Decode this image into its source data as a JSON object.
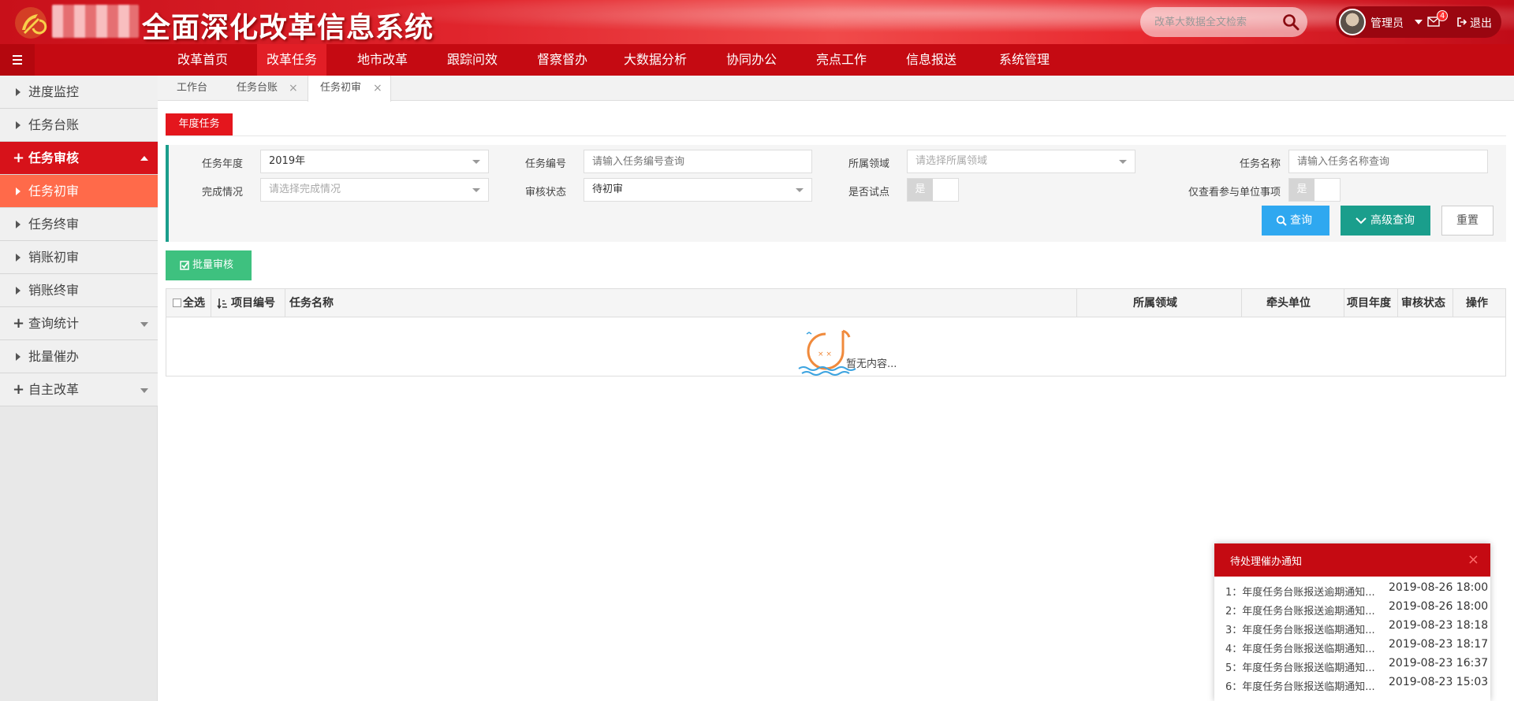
{
  "header": {
    "title": "全面深化改革信息系统",
    "search_placeholder": "改革大数据全文检索",
    "user_name": "管理员",
    "mail_count": "4",
    "logout_label": "退出"
  },
  "nav": {
    "items": [
      "改革首页",
      "改革任务",
      "地市改革",
      "跟踪问效",
      "督察督办",
      "大数据分析",
      "协同办公",
      "亮点工作",
      "信息报送",
      "系统管理"
    ]
  },
  "sidebar": {
    "items": [
      {
        "label": "进度监控"
      },
      {
        "label": "任务台账"
      },
      {
        "label": "任务审核"
      },
      {
        "label": "任务初审"
      },
      {
        "label": "任务终审"
      },
      {
        "label": "销账初审"
      },
      {
        "label": "销账终审"
      },
      {
        "label": "查询统计"
      },
      {
        "label": "批量催办"
      },
      {
        "label": "自主改革"
      }
    ]
  },
  "tabs": [
    "工作台",
    "任务台账",
    "任务初审"
  ],
  "content": {
    "year_tab": "年度任务",
    "filters": {
      "year_label": "任务年度",
      "year_value": "2019年",
      "code_label": "任务编号",
      "code_placeholder": "请输入任务编号查询",
      "field_label": "所属领域",
      "field_placeholder": "请选择所属领域",
      "name_label": "任务名称",
      "name_placeholder": "请输入任务名称查询",
      "completion_label": "完成情况",
      "completion_placeholder": "请选择完成情况",
      "review_label": "审核状态",
      "review_value": "待初审",
      "pilot_label": "是否试点",
      "pilot_toggle": "是",
      "only_label": "仅查看参与单位事项",
      "only_toggle": "是"
    },
    "buttons": {
      "query": "查询",
      "advanced": "高级查询",
      "reset": "重置",
      "batch": "批量审核"
    },
    "table": {
      "headers": [
        "全选",
        "项目编号",
        "任务名称",
        "所属领域",
        "牵头单位",
        "项目年度",
        "审核状态",
        "操作"
      ],
      "empty_text": "暂无内容..."
    }
  },
  "notification": {
    "title": "待处理催办通知",
    "items": [
      {
        "text": "1：年度任务台账报送逾期通知...",
        "time": "2019-08-26 18:00"
      },
      {
        "text": "2：年度任务台账报送逾期通知...",
        "time": "2019-08-26 18:00"
      },
      {
        "text": "3：年度任务台账报送临期通知...",
        "time": "2019-08-23 18:18"
      },
      {
        "text": "4：年度任务台账报送临期通知...",
        "time": "2019-08-23 18:17"
      },
      {
        "text": "5：年度任务台账报送临期通知...",
        "time": "2019-08-23 16:37"
      },
      {
        "text": "6：年度任务台账报送临期通知...",
        "time": "2019-08-23 15:03"
      }
    ]
  }
}
